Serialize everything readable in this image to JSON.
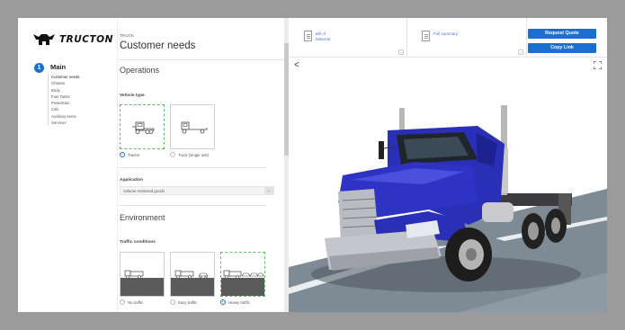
{
  "brand": {
    "name": "TRUCTON"
  },
  "sidebar": {
    "step_number": "1",
    "step_title": "Main",
    "items": [
      {
        "label": "Customer needs",
        "active": true
      },
      {
        "label": "Chassis"
      },
      {
        "label": "Body"
      },
      {
        "label": "Fuel Tanks"
      },
      {
        "label": "Powertrain"
      },
      {
        "label": "Cab"
      },
      {
        "label": "Auxiliary items"
      },
      {
        "label": "Services"
      }
    ]
  },
  "config": {
    "kicker": "TRUCK",
    "title": "Customer needs",
    "operations_title": "Operations",
    "vehicle_type_label": "Vehicle type",
    "vehicle_types": [
      {
        "label": "Tractor",
        "selected": true,
        "icon": "tractor-icon"
      },
      {
        "label": "Truck (single unit)",
        "selected": false,
        "icon": "truck-icon"
      }
    ],
    "application_label": "Application",
    "application_value": "Volume restricted goods",
    "environment_title": "Environment",
    "traffic_label": "Traffic conditions",
    "traffic_options": [
      {
        "label": "No traffic",
        "selected": false
      },
      {
        "label": "Easy traffic",
        "selected": false
      },
      {
        "label": "Heavy traffic",
        "selected": true
      }
    ]
  },
  "topbar": {
    "tabs": [
      {
        "label_line1": "Bill of",
        "label_line2": "Material"
      },
      {
        "label_line1": "Full summary",
        "label_line2": ""
      }
    ],
    "request_quote": "Request Quote",
    "copy_link": "Copy Link"
  },
  "colors": {
    "accent": "#1a6fd0",
    "selection": "#5cc15c",
    "truck_body": "#2a2fb8"
  }
}
